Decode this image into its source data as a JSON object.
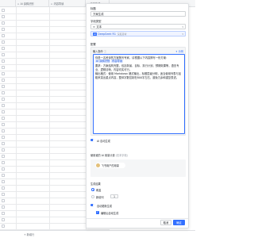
{
  "sheet": {
    "columns": [
      {
        "icon": "A",
        "label": "AI 涂鸦识别"
      },
      {
        "icon": "A",
        "label": "内容导读"
      },
      {
        "icon": "A",
        "label": "方案生成"
      }
    ],
    "footer_add": "+ 新增行"
  },
  "panel": {
    "title_label": "标题",
    "title_value": "方案生成",
    "type_label": "字段类型",
    "type_value": "文本",
    "model_badge": "AI",
    "model_value": "DeepSeek R1",
    "model_tag": "深度思考",
    "config_label": "配置",
    "prompt_head": "输入指令",
    "prompt_link": "示例",
    "prompt_text": {
      "p1_a": "你是",
      "p1_b": "一名资深的方案撰写专家。请根据以下内容撰写一份方案：",
      "tag1": "AI 涂鸦识别",
      "tag2": "内容导读",
      "p2": "要求：方案结构完整，包括背景、目标、执行计划、预期效果等，语言专业、逻辑清晰，内容切实可行。",
      "p3": "输出格式：使用 Markdown 格式输出，标题层级分明，适当使用列表与加粗来突出重点内容，整体字数控制在800字左右，避免冗余和重复表述。"
    },
    "ai_toggle_label": "AI 自动生成",
    "permission_label": "使用谁的 AI 用量计费",
    "permission_hint": "(仅本字段)",
    "user_name": "飞书用户",
    "user_suffix": "的用量",
    "generate_label": "生成结果",
    "radio1_label": "覆盖",
    "radio2_label": "新增列",
    "num_value": "1",
    "auto_update_label": "自动更新生成",
    "checkbox_label": "编辑后自动生成",
    "cancel_label": "取消",
    "ok_label": "确定"
  },
  "colors": {
    "primary": "#3370ff",
    "tag_bg": "#e1eaff"
  }
}
